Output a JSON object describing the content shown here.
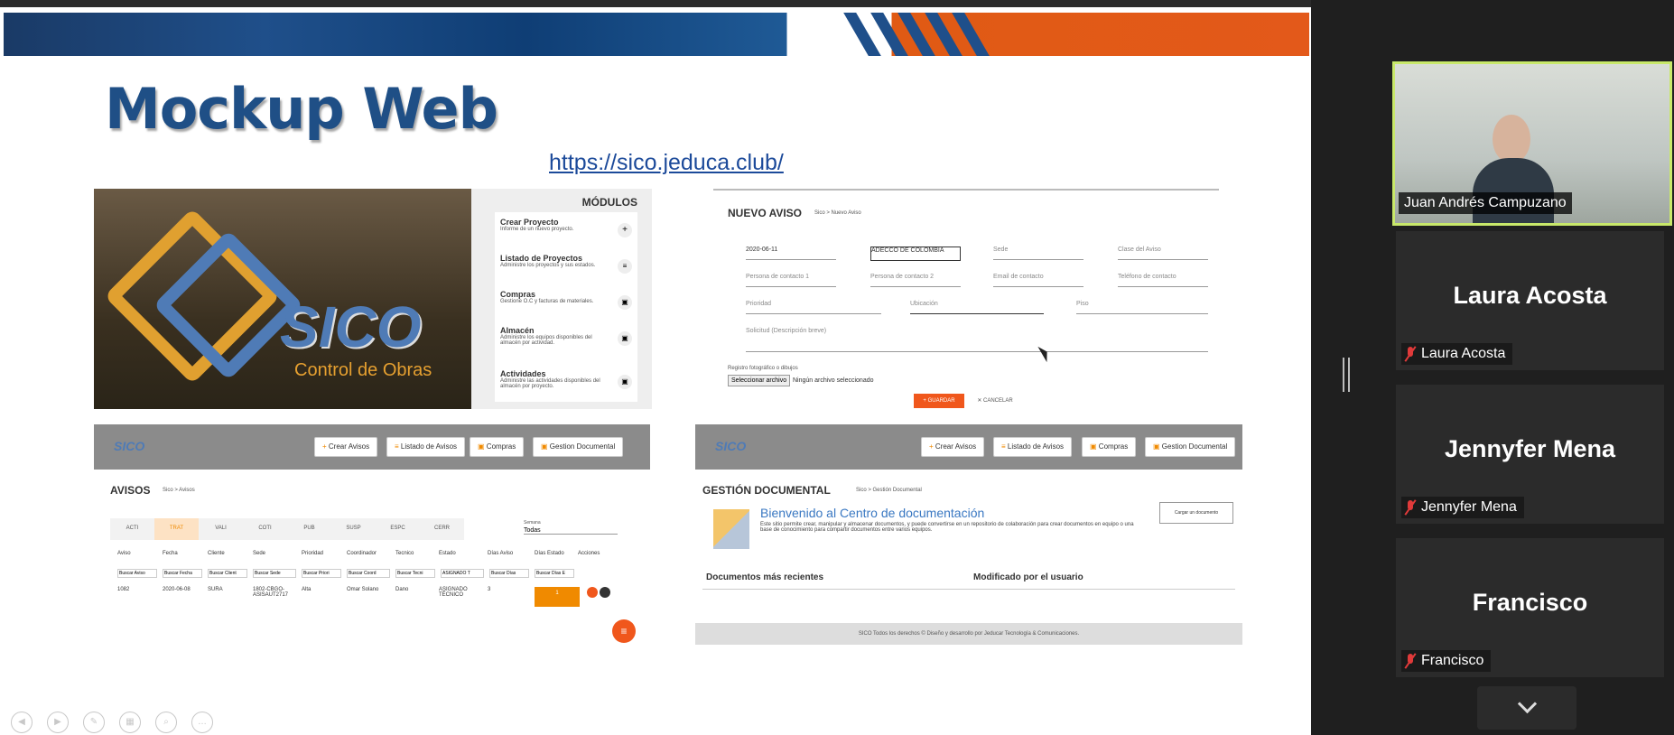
{
  "slide": {
    "title": "Mockup Web",
    "link": "https://sico.jeduca.club/"
  },
  "login_mock": {
    "brand": "SICO",
    "brand_sub": "Control de Obras",
    "modules_title": "MÓDULOS",
    "modules": [
      {
        "name": "Crear Proyecto",
        "desc": "Informe de un nuevo proyecto."
      },
      {
        "name": "Listado de Proyectos",
        "desc": "Administre los proyectos y sus estados."
      },
      {
        "name": "Compras",
        "desc": "Gestione O.C y facturas de materiales."
      },
      {
        "name": "Almacén",
        "desc": "Administre los equipos disponibles del almacén por actividad."
      },
      {
        "name": "Actividades",
        "desc": "Administre las actividades disponibles del almacén por proyecto."
      }
    ]
  },
  "nuevo_aviso": {
    "title": "NUEVO AVISO",
    "crumb": "Sico > Nuevo Aviso",
    "fecha": "2020-06-11",
    "cliente": "ADECCO DE COLOMBIA",
    "sede": "Sede",
    "clase": "Clase del Aviso",
    "p1": "Persona de contacto 1",
    "p2": "Persona de contacto 2",
    "email": "Email de contacto",
    "tel": "Teléfono de contacto",
    "prioridad": "Prioridad",
    "ubicacion": "Ubicación",
    "piso": "Piso",
    "desc": "Solicitud (Descripción breve)",
    "foto_label": "Registro fotográfico o dibujos",
    "file_btn": "Seleccionar archivo",
    "file_none": "Ningún archivo seleccionado",
    "guardar": "+ GUARDAR",
    "cancelar": "✕ CANCELAR"
  },
  "nav": {
    "crear": "Crear Avisos",
    "listado": "Listado de Avisos",
    "compras": "Compras",
    "gestion": "Gestion Documental"
  },
  "avisos": {
    "title": "AVISOS",
    "crumb": "Sico > Avisos",
    "states": [
      "ACTI",
      "TRAT",
      "VALI",
      "COTI",
      "PUB",
      "SUSP",
      "ESPC",
      "CERR"
    ],
    "filter_label": "Semana",
    "filter_value": "Todas",
    "headers": [
      "Aviso",
      "Fecha",
      "Cliente",
      "Sede",
      "Prioridad",
      "Coordinador",
      "Tecnico",
      "Estado",
      "Días Aviso",
      "Días Estado",
      "Acciones"
    ],
    "search": [
      "Buscar Aviso",
      "Buscar Fecha",
      "Buscar Client",
      "Buscar Sede",
      "Buscar Priori",
      "Buscar Coord",
      "Buscar Tecni",
      "ASIGNADO T",
      "Buscar Días",
      "Buscar Días E"
    ],
    "row": [
      "1082",
      "2020-06-08",
      "SURA",
      "1802-CBGO-ASISAUT2717",
      "Alta",
      "Omar Solano",
      "Dano",
      "ASIGNADO TÉCNICO",
      "3",
      "1"
    ]
  },
  "gestion_doc": {
    "title": "GESTIÓN DOCUMENTAL",
    "crumb": "Sico > Gestión Documental",
    "welcome": "Bienvenido al Centro de documentación",
    "welcome_desc": "Este sitio permite crear, manipular y almacenar documentos, y puede convertirse en un repositorio de colaboración para crear documentos en equipo o una base de conocimiento para compartir documentos entre varios equipos.",
    "upload": "Cargar un documento",
    "recent": "Documentos más recientes",
    "modified": "Modificado por el usuario",
    "footer": "SICO Todos los derechos © Diseño y desarrollo por Jeducar Tecnología & Comunicaciones."
  },
  "participants": [
    {
      "name": "Juan Andrés Campuzano",
      "video": true
    },
    {
      "name": "Laura Acosta",
      "muted": true
    },
    {
      "name": "Jennyfer Mena",
      "muted": true
    },
    {
      "name": "Francisco",
      "muted": true
    }
  ],
  "colors": {
    "accent_orange": "#f08a00",
    "slide_blue": "#1f4f86",
    "active_speaker": "#c8e86a"
  }
}
